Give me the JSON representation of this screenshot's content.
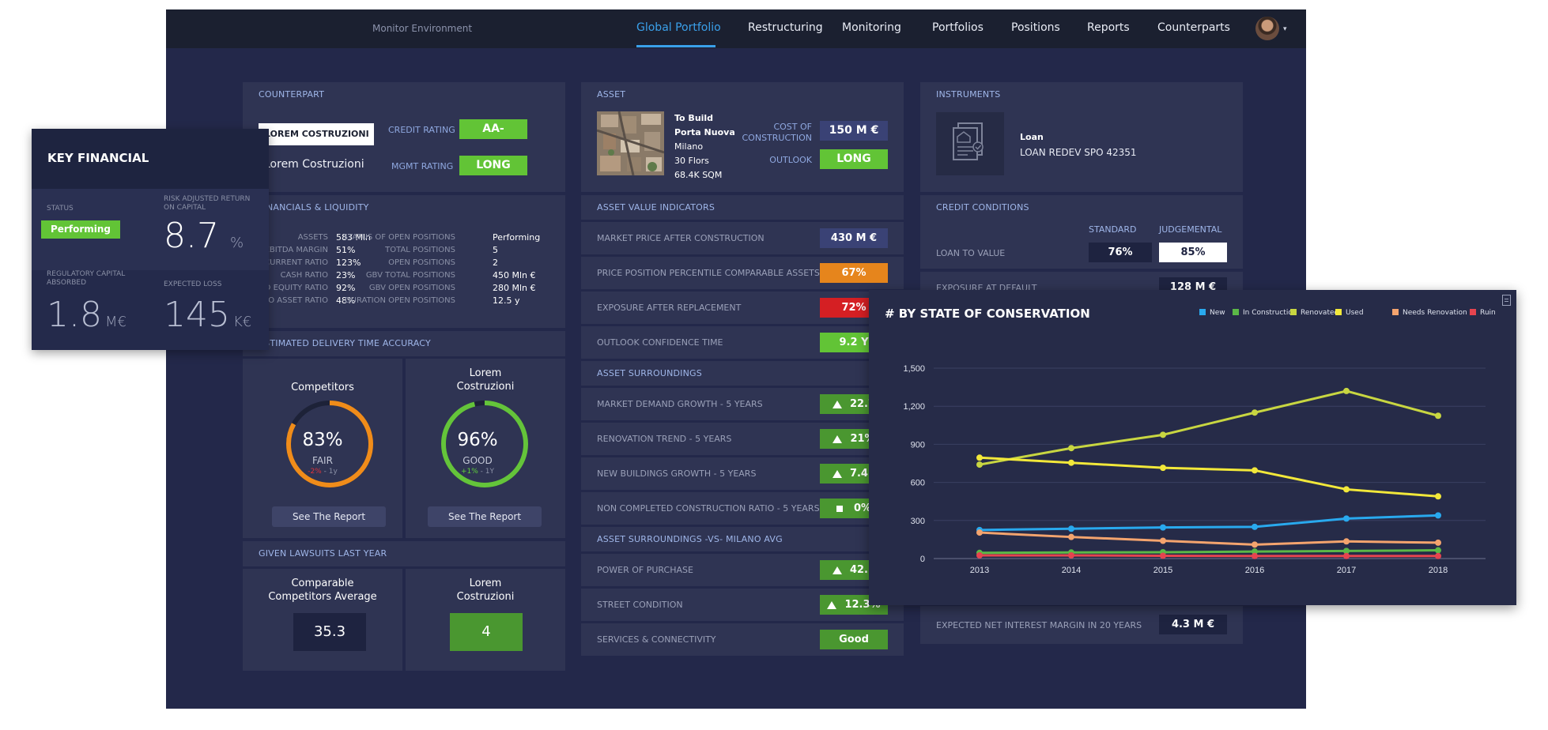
{
  "topbar": {
    "environment": "Monitor Environment",
    "nav": [
      "Global Portfolio",
      "Restructuring",
      "Monitoring",
      "Portfolios",
      "Positions",
      "Reports",
      "Counterparts"
    ],
    "active_nav": "Global Portfolio",
    "caret": "▾"
  },
  "counterpart": {
    "title": "COUNTERPART",
    "company_input": "LOREM COSTRUZIONI",
    "company_name": "Lorem Costruzioni",
    "credit_rating_label": "CREDIT RATING",
    "credit_rating": "AA-",
    "mgmt_rating_label": "MGMT RATING",
    "mgmt_rating": "LONG"
  },
  "financials": {
    "title": "FINANCIALS & LIQUIDITY",
    "left": [
      {
        "k": "ASSETS",
        "v": "583 Mln"
      },
      {
        "k": "EBITDA MARGIN",
        "v": "51%"
      },
      {
        "k": "CURRENT RATIO",
        "v": "123%"
      },
      {
        "k": "CASH RATIO",
        "v": "23%"
      },
      {
        "k": "DEBT TO EQUITY RATIO",
        "v": "92%"
      },
      {
        "k": "DEBT TO ASSET RATIO",
        "v": "48%"
      }
    ],
    "right": [
      {
        "k": "STATUS OF OPEN POSITIONS",
        "v": "Performing"
      },
      {
        "k": "TOTAL POSITIONS",
        "v": "5"
      },
      {
        "k": "OPEN POSITIONS",
        "v": "2"
      },
      {
        "k": "GBV TOTAL POSITIONS",
        "v": "450 Mln €"
      },
      {
        "k": "GBV OPEN POSITIONS",
        "v": "280 Mln €"
      },
      {
        "k": "DURATION OPEN POSITIONS",
        "v": "12.5 y"
      }
    ]
  },
  "delivery": {
    "title": "ESTIMATED DELIVERY TIME ACCURACY",
    "competitors": {
      "name": "Competitors",
      "pct": "83%",
      "pct_value": 83,
      "grade": "FAIR",
      "delta": "-2%",
      "period": "- 1y",
      "button": "See The Report",
      "color": "#f08c1a",
      "delta_color": "#e0333a"
    },
    "company": {
      "name": "Lorem Costruzioni",
      "pct": "96%",
      "pct_value": 96,
      "grade": "GOOD",
      "delta": "+1%",
      "period": "- 1Y",
      "button": "See The Report",
      "color": "#64c43a",
      "delta_color": "#5fd13a"
    }
  },
  "lawsuits": {
    "title": "GIVEN LAWSUITS LAST YEAR",
    "competitors_label": "Comparable Competitors Average",
    "competitors_value": "35.3",
    "company_label": "Lorem Costruzioni",
    "company_value": "4"
  },
  "asset": {
    "title": "ASSET",
    "lines": [
      "To Build",
      "Porta Nuova",
      "Milano",
      "30 Flors",
      "68.4K SQM"
    ],
    "cost_label": "COST OF CONSTRUCTION",
    "cost": "150 M €",
    "outlook_label": "OUTLOOK",
    "outlook": "LONG"
  },
  "asset_value_indicators": {
    "title": "ASSET VALUE INDICATORS",
    "rows": [
      {
        "label": "MARKET PRICE AFTER CONSTRUCTION",
        "value": "430 M €",
        "style": "navy"
      },
      {
        "label": "PRICE POSITION PERCENTILE COMPARABLE ASSETS",
        "value": "67%",
        "style": "orange"
      },
      {
        "label": "EXPOSURE AFTER REPLACEMENT",
        "value": "72%",
        "style": "red"
      },
      {
        "label": "OUTLOOK CONFIDENCE TIME",
        "value": "9.2 Y",
        "style": "green"
      }
    ]
  },
  "asset_surroundings": {
    "title": "ASSET SURROUNDINGS",
    "rows": [
      {
        "label": "MARKET DEMAND GROWTH - 5 YEARS",
        "value": "22.7",
        "icon": "up"
      },
      {
        "label": "RENOVATION TREND - 5 YEARS",
        "value": "21%",
        "icon": "up"
      },
      {
        "label": "NEW BUILDINGS GROWTH - 5 YEARS",
        "value": "7.42",
        "icon": "up"
      },
      {
        "label": "NON COMPLETED CONSTRUCTION RATIO - 5 YEARS",
        "value": "0%",
        "icon": "flat"
      }
    ]
  },
  "asset_vs": {
    "title": "ASSET SURROUNDINGS -VS- MILANO AVG",
    "rows": [
      {
        "label": "POWER OF PURCHASE",
        "value": "42.5",
        "icon": "up"
      },
      {
        "label": "STREET CONDITION",
        "value": "12.3%",
        "icon": "up"
      },
      {
        "label": "SERVICES & CONNECTIVITY",
        "value": "Good",
        "icon": "none"
      }
    ]
  },
  "instruments": {
    "title": "INSTRUMENTS",
    "type": "Loan",
    "name": "LOAN REDEV SPO 42351"
  },
  "credit_conditions": {
    "title": "CREDIT CONDITIONS",
    "col_standard": "STANDARD",
    "col_judgemental": "JUDGEMENTAL",
    "ltv_label": "LOAN TO VALUE",
    "ltv_standard": "76%",
    "ltv_judgemental": "85%",
    "ead_label": "EXPOSURE AT DEFAULT",
    "ead_value": "128 M €",
    "nim_label": "EXPECTED NET INTEREST MARGIN IN 20 YEARS",
    "nim_value": "4.3 M €"
  },
  "key_financial": {
    "title": "KEY FINANCIAL",
    "status_label": "STATUS",
    "status": "Performing",
    "raroc_label": "RISK ADJUSTED RETURN ON CAPITAL",
    "raroc_value": "8.7",
    "raroc_unit": "%",
    "rca_label": "REGULATORY CAPITAL ABSORBED",
    "rca_value": "1.8",
    "rca_unit": "M€",
    "el_label": "EXPECTED LOSS",
    "el_value": "145",
    "el_unit": "K€"
  },
  "chart_data": {
    "type": "line",
    "title": "# BY STATE OF CONSERVATION",
    "categories": [
      "2013",
      "2014",
      "2015",
      "2016",
      "2017",
      "2018"
    ],
    "ylim": [
      0,
      1500
    ],
    "yticks": [
      "0",
      "300",
      "600",
      "900",
      "1,200",
      "1,500"
    ],
    "ytick_values": [
      0,
      300,
      600,
      900,
      1200,
      1500
    ],
    "legend_position": "top-right",
    "grid": true,
    "series": [
      {
        "name": "New",
        "color": "#29a9ee",
        "values": [
          225,
          235,
          245,
          250,
          315,
          340
        ]
      },
      {
        "name": "In Construction",
        "color": "#5bb847",
        "values": [
          45,
          48,
          50,
          55,
          60,
          65
        ]
      },
      {
        "name": "Renovated",
        "color": "#c8d641",
        "values": [
          740,
          870,
          975,
          1150,
          1320,
          1125
        ]
      },
      {
        "name": "Used",
        "color": "#f2e83a",
        "values": [
          795,
          755,
          715,
          695,
          545,
          490
        ]
      },
      {
        "name": "Needs Renovation",
        "color": "#f4a46e",
        "values": [
          205,
          170,
          140,
          110,
          135,
          125
        ]
      },
      {
        "name": "Ruin",
        "color": "#e5444f",
        "values": [
          25,
          25,
          22,
          20,
          20,
          20
        ]
      }
    ]
  }
}
